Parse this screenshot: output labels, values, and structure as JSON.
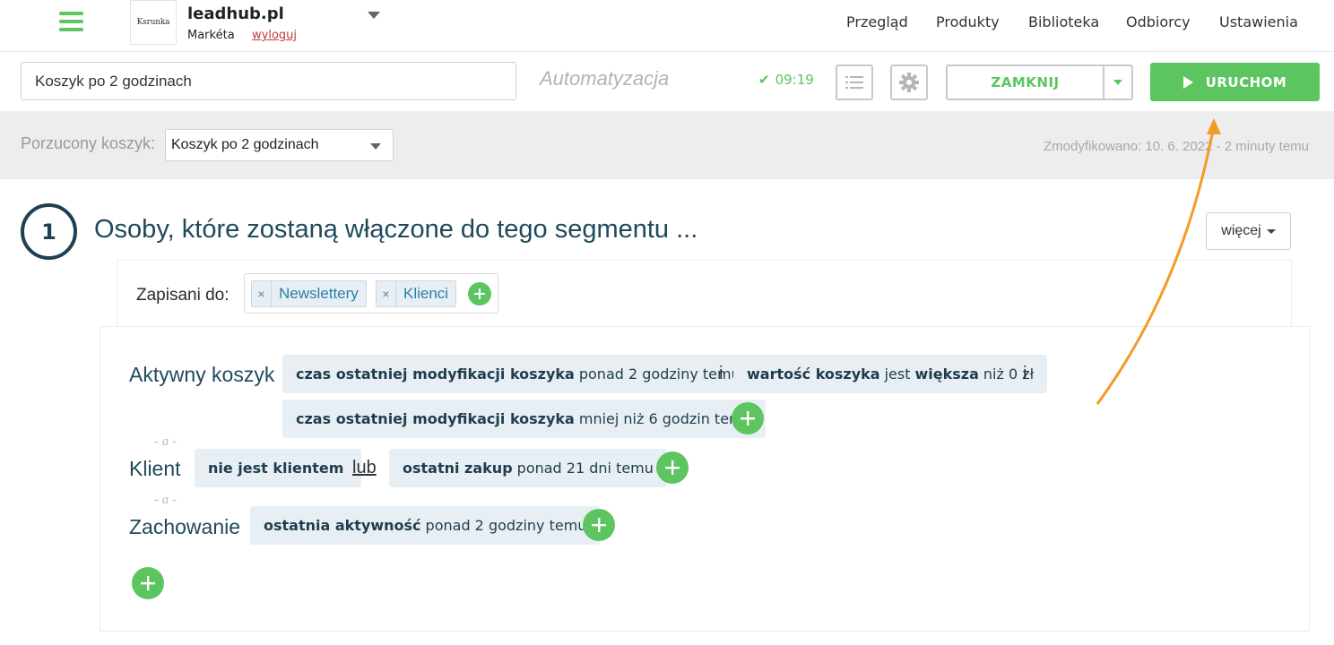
{
  "header": {
    "logo_text": "Ksrunka",
    "account_name": "leadhub.pl",
    "user_name": "Markéta",
    "logout_label": "wyloguj",
    "nav": [
      "Przegląd",
      "Produkty",
      "Biblioteka",
      "Odbiorcy",
      "Ustawienia"
    ]
  },
  "toolbar": {
    "automation_name": "Koszyk po 2 godzinach",
    "type_label": "Automatyzacja",
    "saved_time": "09:19",
    "close_label": "ZAMKNIJ",
    "run_label": "URUCHOM"
  },
  "band": {
    "label": "Porzucony koszyk:",
    "selected": "Koszyk po 2 godzinach",
    "modified": "Zmodyfikowano: 10. 6. 2022 - 2 minuty temu"
  },
  "segment": {
    "step": "1",
    "title": "Osoby, które zostaną włączone do tego segmentu ...",
    "more_label": "więcej",
    "subscribed_label": "Zapisani do:",
    "tags": [
      "Newslettery",
      "Klienci"
    ],
    "separator": "- a -",
    "rows": {
      "cart": {
        "label": "Aktywny koszyk",
        "c1_bold": "czas ostatniej modyfikacji koszyka",
        "c1_rest": "ponad 2 godziny temu",
        "conj1": "i",
        "c2_bold1": "wartość koszyka",
        "c2_mid": "jest",
        "c2_bold2": "większa",
        "c2_rest": "niż 0 zł",
        "conj2": "i",
        "c3_bold": "czas ostatniej modyfikacji koszyka",
        "c3_rest": "mniej niż 6 godzin temu"
      },
      "client": {
        "label": "Klient",
        "c1_bold": "nie jest klientem",
        "conj": "lub",
        "c2_bold": "ostatni zakup",
        "c2_rest": "ponad 21 dni temu"
      },
      "behavior": {
        "label": "Zachowanie",
        "c1_bold": "ostatnia aktywność",
        "c1_rest": "ponad 2 godziny temu"
      }
    }
  },
  "colors": {
    "accent": "#5cc55f",
    "title": "#1f4a5c",
    "chip_bg": "#e8eff4",
    "annotation_arrow": "#f29b25"
  }
}
